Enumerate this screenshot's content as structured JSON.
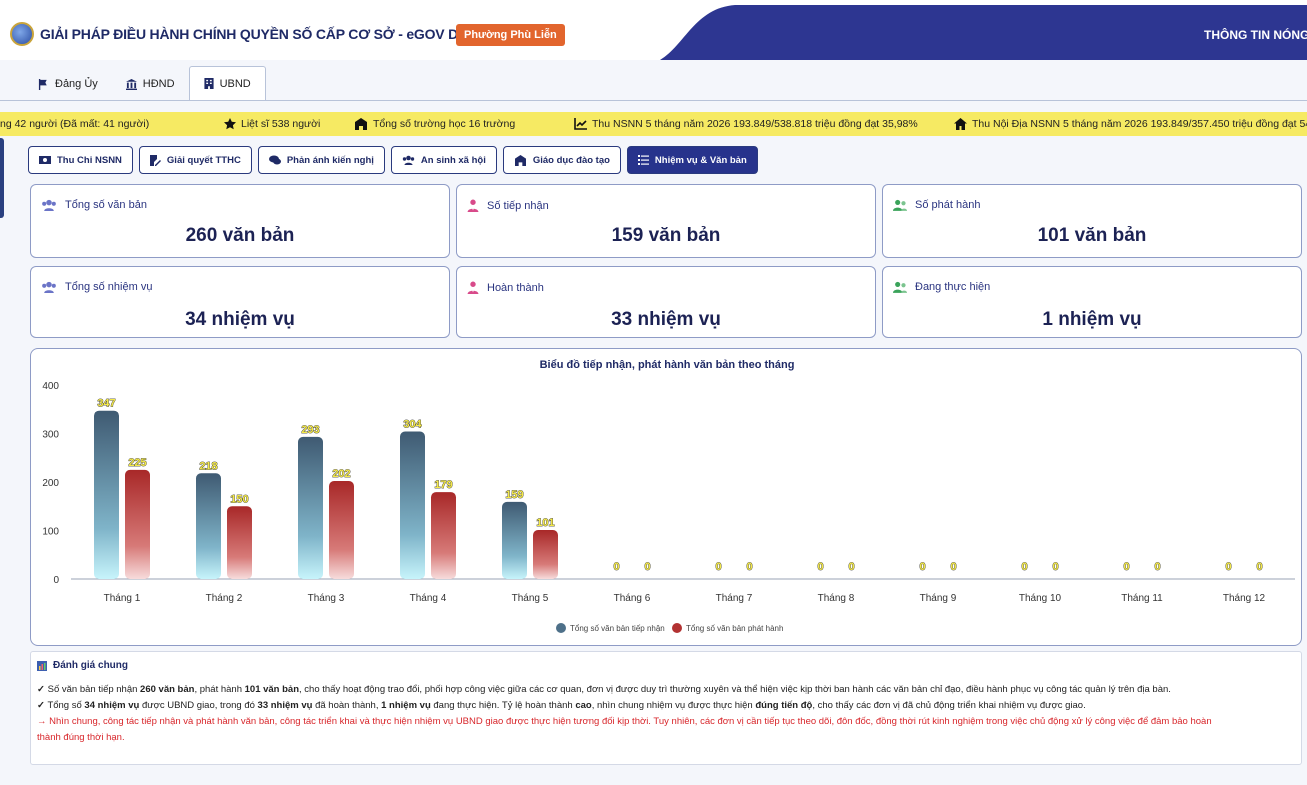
{
  "header": {
    "title": "GIẢI PHÁP ĐIỀU HÀNH CHÍNH QUYỀN SỐ CẤP CƠ SỞ - eGOV DSS",
    "ward": "Phường Phù Liễn",
    "hot_news": "THÔNG TIN NÓNG"
  },
  "top_tabs": [
    {
      "label": "Đảng Ủy",
      "icon": "flag-icon"
    },
    {
      "label": "HĐND",
      "icon": "building-columns-icon"
    },
    {
      "label": "UBND",
      "icon": "office-building-icon",
      "active": true
    }
  ],
  "ticker": [
    {
      "text": "ng 42 người (Đã mất: 41 người)",
      "icon": ""
    },
    {
      "text": "Liệt sĩ 538 người",
      "icon": "star-icon"
    },
    {
      "text": "Tổng số trường học 16 trường",
      "icon": "school-icon"
    },
    {
      "text": "Thu NSNN 5 tháng năm 2026 193.849/538.818 triệu đồng đạt 35,98%",
      "icon": "chart-line-icon"
    },
    {
      "text": "Thu Nội Địa NSNN 5 tháng năm 2026 193.849/357.450 triệu đồng đạt 54,2",
      "icon": "home-icon"
    }
  ],
  "categories": [
    {
      "label": "Thu Chi NSNN",
      "icon": "money-icon"
    },
    {
      "label": "Giải quyết TTHC",
      "icon": "document-edit-icon"
    },
    {
      "label": "Phản ánh kiến nghị",
      "icon": "comments-icon"
    },
    {
      "label": "An sinh xã hội",
      "icon": "users-icon"
    },
    {
      "label": "Giáo dục đào tạo",
      "icon": "school-icon"
    },
    {
      "label": "Nhiệm vụ & Văn bản",
      "icon": "list-icon",
      "active": true
    }
  ],
  "cards": [
    {
      "label": "Tổng số văn bản",
      "value": "260 văn bản",
      "icon": "users-icon"
    },
    {
      "label": "Số tiếp nhận",
      "value": "159 văn bản",
      "icon": "user-tie-icon"
    },
    {
      "label": "Số phát hành",
      "value": "101 văn bản",
      "icon": "user-group-icon"
    },
    {
      "label": "Tổng số nhiệm vụ",
      "value": "34 nhiệm vụ",
      "icon": "users-icon"
    },
    {
      "label": "Hoàn thành",
      "value": "33 nhiệm vụ",
      "icon": "user-tie-icon"
    },
    {
      "label": "Đang thực hiện",
      "value": "1 nhiệm vụ",
      "icon": "user-group-icon"
    }
  ],
  "colors": {
    "accent": "#27338c",
    "received_bar": "#4e7089",
    "issued_bar": "#b23232",
    "ticker_bg": "#f6ea63",
    "badge": "#e2652d"
  },
  "chart_data": {
    "type": "bar",
    "title": "Biểu đồ tiếp nhận, phát hành văn bản theo tháng",
    "categories": [
      "Tháng 1",
      "Tháng 2",
      "Tháng 3",
      "Tháng 4",
      "Tháng 5",
      "Tháng 6",
      "Tháng 7",
      "Tháng 8",
      "Tháng 9",
      "Tháng 10",
      "Tháng 11",
      "Tháng 12"
    ],
    "series": [
      {
        "name": "Tổng số văn bản tiếp nhận",
        "values": [
          347,
          218,
          293,
          304,
          159,
          0,
          0,
          0,
          0,
          0,
          0,
          0
        ]
      },
      {
        "name": "Tổng số văn bản phát hành",
        "values": [
          225,
          150,
          202,
          179,
          101,
          0,
          0,
          0,
          0,
          0,
          0,
          0
        ]
      }
    ],
    "ylim": [
      0,
      400
    ],
    "yticks": [
      "0",
      "100",
      "200",
      "300",
      "400"
    ],
    "grid": false,
    "legend": "bottom"
  },
  "assessment": {
    "title": "Đánh giá chung",
    "line1": {
      "a": "Số văn bản tiếp nhận ",
      "b": "260 văn bản",
      "c": ", phát hành ",
      "d": "101 văn bản",
      "e": ", cho thấy hoạt động trao đổi, phối hợp công việc giữa các cơ quan, đơn vị được duy trì thường xuyên và thể hiện việc kịp thời ban hành các văn bản chỉ đạo, điều hành phục vụ công tác quản lý trên địa bàn."
    },
    "line2": {
      "a": "Tổng số ",
      "b": "34 nhiệm vụ",
      "c": " được UBND giao, trong đó ",
      "d": "33 nhiệm vụ",
      "e": " đã hoàn thành, ",
      "f": "1 nhiệm vụ",
      "g": " đang thực hiện. Tỷ lệ hoàn thành ",
      "h": "cao",
      "i": ", nhìn chung nhiệm vụ được thực hiện ",
      "j": "đúng tiến độ",
      "k": ", cho thấy các đơn vị đã chủ động triển khai nhiệm vụ được giao."
    },
    "line3": "→ Nhìn chung, công tác tiếp nhận và phát hành văn bản, công tác triển khai và thực hiện nhiệm vụ UBND giao được thực hiện tương đối kịp thời. Tuy nhiên, các đơn vị cần tiếp tục theo dõi, đôn đốc, đồng thời rút kinh nghiệm trong việc chủ động xử lý công việc để đảm bảo hoàn",
    "line4": "thành đúng thời hạn."
  }
}
